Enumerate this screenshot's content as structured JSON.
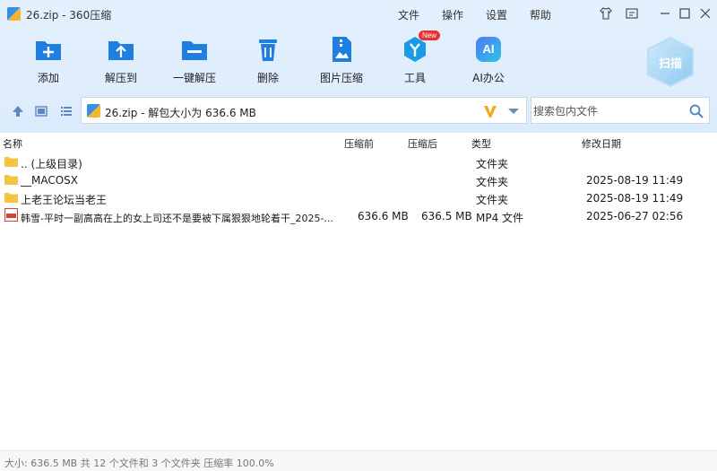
{
  "window": {
    "title": "26.zip - 360压缩",
    "menu": [
      "文件",
      "操作",
      "设置",
      "帮助"
    ]
  },
  "toolbar": {
    "buttons": [
      {
        "label": "添加",
        "icon": "add-icon"
      },
      {
        "label": "解压到",
        "icon": "extract-to-icon"
      },
      {
        "label": "一键解压",
        "icon": "one-click-extract-icon"
      },
      {
        "label": "删除",
        "icon": "trash-icon"
      },
      {
        "label": "图片压缩",
        "icon": "image-compress-icon"
      },
      {
        "label": "工具",
        "icon": "tools-icon",
        "badge": "New"
      },
      {
        "label": "AI办公",
        "icon": "ai-icon",
        "icon_text": "AI"
      }
    ],
    "scan_label": "扫描"
  },
  "address": {
    "path_text": "26.zip - 解包大小为 636.6 MB"
  },
  "search": {
    "placeholder": "搜索包内文件"
  },
  "columns": [
    "名称",
    "压缩前",
    "压缩后",
    "类型",
    "修改日期"
  ],
  "files": [
    {
      "name": ".. (上级目录)",
      "type": "文件夹",
      "size": "",
      "packed": "",
      "modified": "",
      "icon": "folder-icon"
    },
    {
      "name": "__MACOSX",
      "type": "文件夹",
      "size": "",
      "packed": "",
      "modified": "2025-08-19 11:49",
      "icon": "folder-icon"
    },
    {
      "name": "上老王论坛当老王",
      "type": "文件夹",
      "size": "",
      "packed": "",
      "modified": "2025-08-19 11:49",
      "icon": "folder-icon"
    },
    {
      "name": "韩雪-平时一副高高在上的女上司还不是要被下属狠狠地轮着干_2025-...",
      "type": "MP4 文件",
      "size": "636.6 MB",
      "packed": "636.5 MB",
      "modified": "2025-06-27 02:56",
      "icon": "video-file-icon"
    }
  ],
  "status": "大小: 636.5 MB 共 12 个文件和 3 个文件夹 压缩率 100.0%",
  "colors": {
    "accent": "#2a86e8",
    "toolbar_bg": "#e0eefd"
  }
}
